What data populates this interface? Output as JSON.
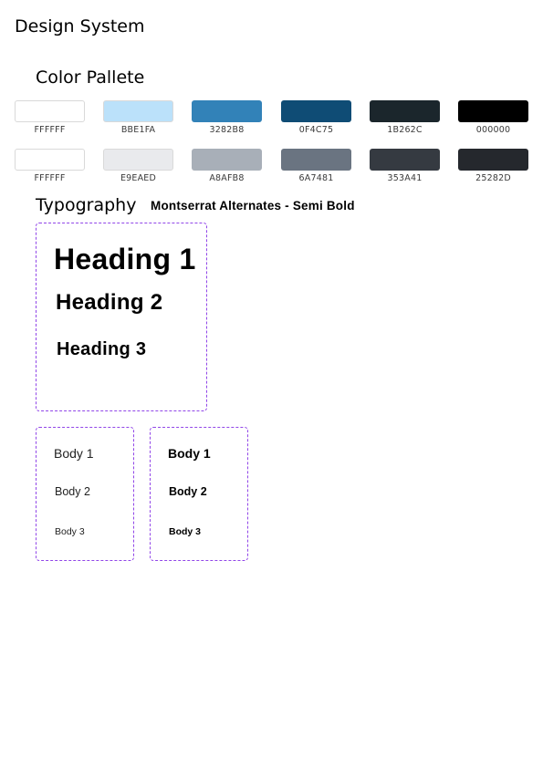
{
  "page": {
    "title": "Design System"
  },
  "color_palette": {
    "title": "Color Pallete",
    "row1": [
      {
        "label": "FFFFFF",
        "color": "#FFFFFF"
      },
      {
        "label": "BBE1FA",
        "color": "#BBE1FA"
      },
      {
        "label": "3282B8",
        "color": "#3282B8"
      },
      {
        "label": "0F4C75",
        "color": "#0F4C75"
      },
      {
        "label": "1B262C",
        "color": "#1B262C"
      },
      {
        "label": "000000",
        "color": "#000000"
      }
    ],
    "row2": [
      {
        "label": "FFFFFF",
        "color": "#FFFFFF"
      },
      {
        "label": "E9EAED",
        "color": "#E9EAED"
      },
      {
        "label": "A8AFB8",
        "color": "#A8AFB8"
      },
      {
        "label": "6A7481",
        "color": "#6A7481"
      },
      {
        "label": "353A41",
        "color": "#353A41"
      },
      {
        "label": "25282D",
        "color": "#25282D"
      }
    ]
  },
  "typography": {
    "title": "Typography",
    "font_name": "Montserrat Alternates - Semi Bold",
    "headings": {
      "h1": "Heading 1",
      "h2": "Heading 2",
      "h3": "Heading 3"
    },
    "body_regular": {
      "b1": "Body 1",
      "b2": "Body 2",
      "b3": "Body 3"
    },
    "body_bold": {
      "b1": "Body 1",
      "b2": "Body 2",
      "b3": "Body 3"
    },
    "accent_border_color": "#9146E8"
  }
}
